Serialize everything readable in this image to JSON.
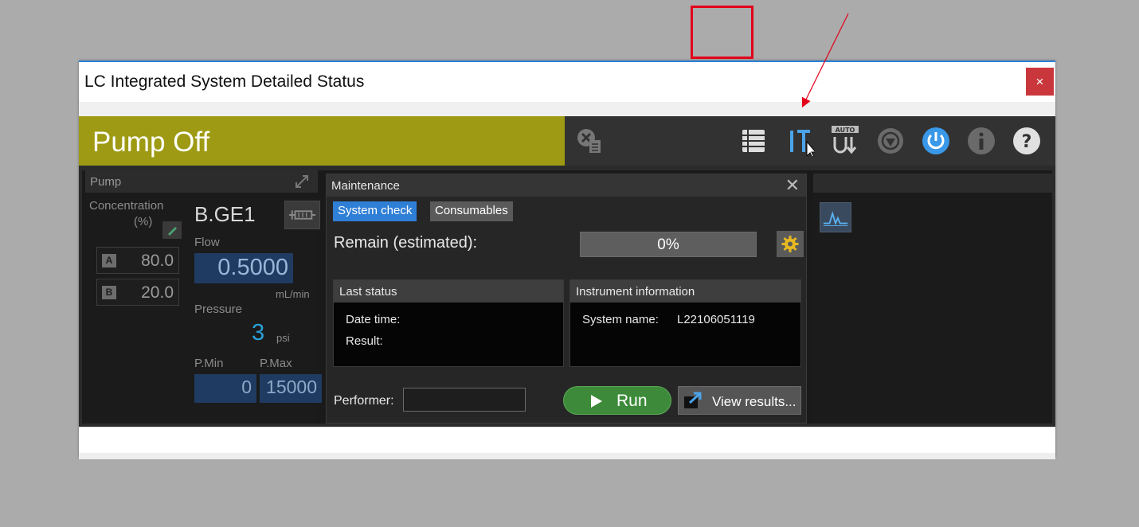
{
  "window": {
    "title": "LC Integrated System Detailed Status",
    "close_glyph": "×"
  },
  "status": {
    "text": "Pump Off",
    "color": "#9e9a13"
  },
  "toolbar": {
    "icons": [
      "remove-sample-icon",
      "sample-list-icon",
      "maintenance-tools-icon",
      "auto-purge-icon",
      "stop-icon",
      "power-icon",
      "info-icon",
      "help-icon"
    ],
    "highlighted": "maintenance-tools-icon",
    "auto_label": "AUTO",
    "highlight_color": "#e2001a"
  },
  "pump": {
    "header": "Pump",
    "concentration_label": "Concentration",
    "percent_label": "(%)",
    "name": "B.GE1",
    "channels": [
      {
        "badge": "A",
        "value": "80.0"
      },
      {
        "badge": "B",
        "value": "20.0"
      }
    ],
    "flow_label": "Flow",
    "flow_value": "0.5000",
    "flow_unit": "mL/min",
    "pressure_label": "Pressure",
    "pressure_value": "3",
    "pressure_unit": "psi",
    "pmin_label": "P.Min",
    "pmax_label": "P.Max",
    "pmin_value": "0",
    "pmax_value": "15000"
  },
  "maintenance": {
    "header": "Maintenance",
    "close_glyph": "✕",
    "tabs": [
      {
        "label": "System check",
        "active": true
      },
      {
        "label": "Consumables",
        "active": false
      }
    ],
    "remain_label": "Remain (estimated):",
    "remain_percent": 0,
    "remain_text": "0%",
    "last_status": {
      "header": "Last status",
      "date_time_label": "Date time:",
      "result_label": "Result:"
    },
    "instrument": {
      "header": "Instrument information",
      "system_name_label": "System name:",
      "system_name_value": "L22106051119"
    },
    "performer_label": "Performer:",
    "performer_value": "",
    "run_label": "Run",
    "view_results_label": "View results..."
  },
  "accent_color": "#2f7fd6",
  "run_color": "#3d8b3a"
}
